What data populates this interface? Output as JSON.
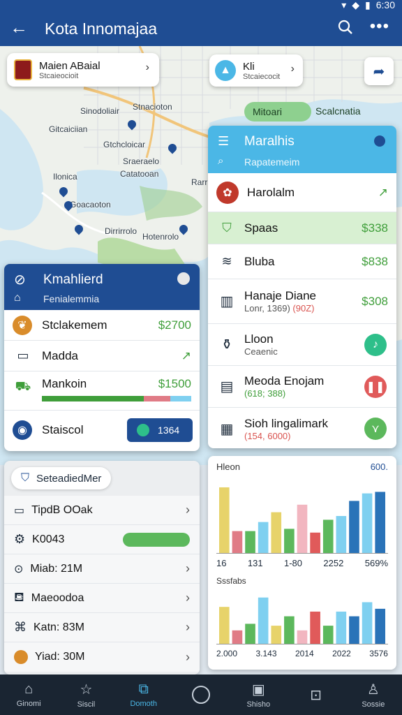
{
  "status": {
    "time": "6:30"
  },
  "appbar": {
    "title": "Kota Innomajaa"
  },
  "map": {
    "chip_left": {
      "title": "Maien ABaial",
      "subtitle": "Stcaieocioit"
    },
    "chip_mid": {
      "title": "Kli",
      "subtitle": "Stcaiecocit"
    },
    "green_chip": "Mitoari",
    "right_label": "Scalcnatia",
    "labels": [
      "Stnacioton",
      "Sinodoliair",
      "Gitcaiciian",
      "Gtchcloicar",
      "Ilonica",
      "Sraeraelo",
      "Catatooan",
      "Goacaoton",
      "Dirrirrolo",
      "Hotenrolo",
      "Rarr"
    ]
  },
  "card_right": {
    "title": "Maralhis",
    "search": "Rapatemeim",
    "rows": [
      {
        "label": "Harolalm",
        "sub": "",
        "value": ""
      },
      {
        "label": "Spaas",
        "sub": "",
        "value": "$338"
      },
      {
        "label": "Bluba",
        "sub": "",
        "value": "$838"
      },
      {
        "label": "Hanaje Diane",
        "sub": "Lonr, 1369)",
        "sub_red": "(90Z)",
        "value": "$308"
      },
      {
        "label": "Lloon",
        "sub": "Ceaenic",
        "value": ""
      },
      {
        "label": "Meoda Enojam",
        "sub": "(618; 388)",
        "value": ""
      },
      {
        "label": "Sioh lingalimark",
        "sub": "(154, 6000)",
        "value": ""
      }
    ]
  },
  "card_left": {
    "title": "Kmahlierd",
    "subtitle": "Fenialemmia",
    "rows": [
      {
        "label": "Stclakemem",
        "value": "$2700"
      },
      {
        "label": "Madda",
        "value": ""
      },
      {
        "label": "Mankoin",
        "value": "$1500"
      },
      {
        "label": "Staiscol",
        "value": "1364"
      }
    ]
  },
  "panel2": {
    "chip": "SeteadiedMer",
    "rows": [
      {
        "label": "TipdB OOak"
      },
      {
        "label": "K0043"
      },
      {
        "label": "Miab: 21M"
      },
      {
        "label": "Maeoodoa"
      },
      {
        "label": "Katn: 83M"
      },
      {
        "label": "Yiad: 30M"
      }
    ]
  },
  "chart_data": [
    {
      "type": "bar",
      "title": "Hleon",
      "corner_label": "600.",
      "categories": [
        "16",
        "131",
        "1-80",
        "2252",
        "569%"
      ],
      "colors": [
        "#e7d36a",
        "#e07b86",
        "#5cb85c",
        "#7fd0f0",
        "#e7d36a",
        "#5cb85c",
        "#f2b6c0",
        "#e05a5a",
        "#5cb85c",
        "#7fd0f0",
        "#2a73b8"
      ],
      "values": [
        88,
        30,
        30,
        42,
        55,
        33,
        65,
        28,
        45,
        50,
        70,
        80,
        82
      ]
    },
    {
      "type": "bar",
      "title": "Sssfabs",
      "categories": [
        "2.000",
        "3.143",
        "2014",
        "2022",
        "3576"
      ],
      "values": [
        40,
        15,
        22,
        50,
        20,
        30,
        15,
        35,
        20,
        35,
        30,
        45,
        38
      ]
    }
  ],
  "bottomnav": [
    {
      "label": "Ginomi",
      "icon": "home-icon"
    },
    {
      "label": "Siscil",
      "icon": "star-icon"
    },
    {
      "label": "Domoth",
      "icon": "chart-icon"
    },
    {
      "label": "",
      "icon": "circle-icon"
    },
    {
      "label": "Shisho",
      "icon": "photo-icon"
    },
    {
      "label": "",
      "icon": "bookmark-icon"
    },
    {
      "label": "Sossie",
      "icon": "person-icon"
    }
  ]
}
